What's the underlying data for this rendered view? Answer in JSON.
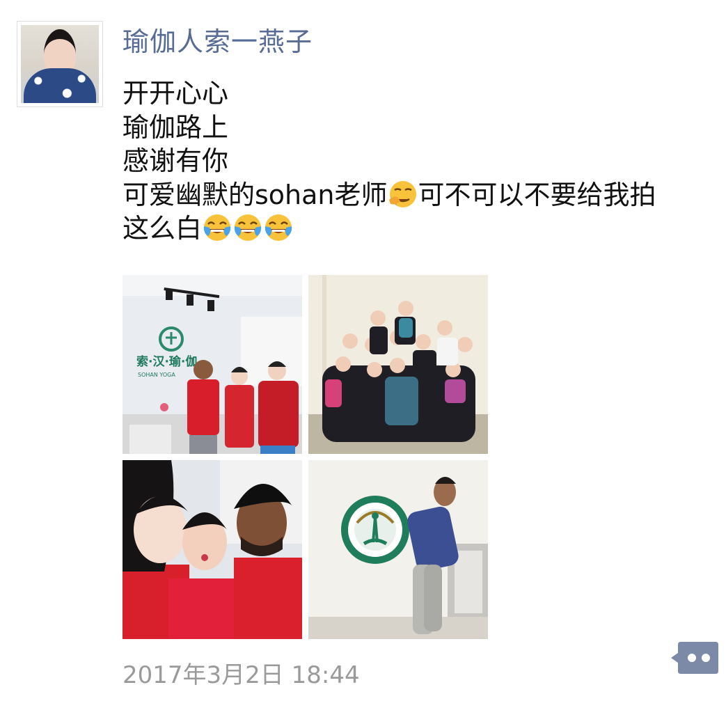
{
  "post": {
    "username": "瑜伽人索一燕子",
    "message_lines": [
      {
        "text": "开开心心"
      },
      {
        "text": "瑜伽路上"
      },
      {
        "text": "感谢有你"
      },
      {
        "text_before": "可爱幽默的sohan老师",
        "emoji": "face-palm-crying-emoji",
        "text_after": "可不可以不要给我拍"
      },
      {
        "text_before": "这么白",
        "emojis": [
          "tears-of-joy-emoji",
          "tears-of-joy-emoji",
          "tears-of-joy-emoji"
        ]
      }
    ],
    "photos": [
      {
        "icon": "studio-photo",
        "sign_text": "索·汉·瑜·伽",
        "sign_subtext": "SOHAN YOGA"
      },
      {
        "icon": "group-photo"
      },
      {
        "icon": "selfie-photo"
      },
      {
        "icon": "yoga-pose-photo"
      }
    ],
    "timestamp": "2017年3月2日 18:44",
    "more_icon": "comment-dots-icon"
  },
  "colors": {
    "username": "#586b95",
    "text": "#111111",
    "timestamp": "#9a9a9a",
    "more_button_bg": "#7c8aa8"
  }
}
